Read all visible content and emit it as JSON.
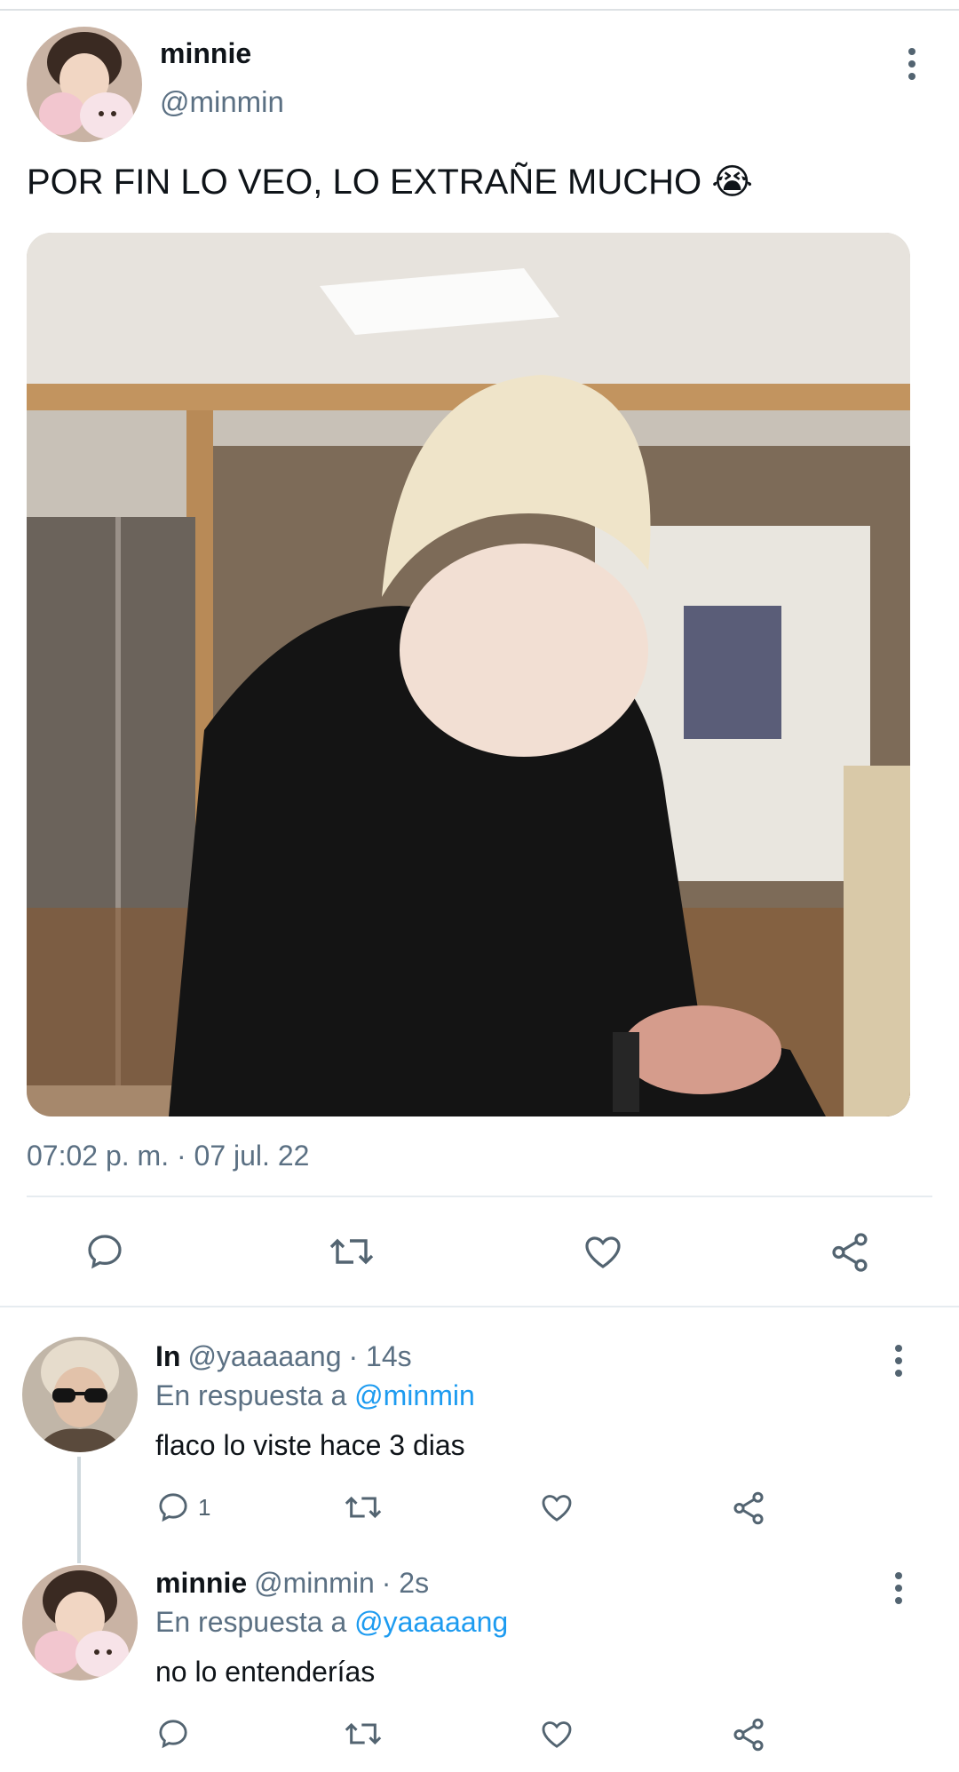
{
  "tweet": {
    "author_name": "minnie",
    "author_handle": "@minmin",
    "text": "POR FIN LO VEO, LO EXTRAÑE MUCHO",
    "emoji": "😭",
    "timestamp": "07:02 p. m. · 07 jul. 22"
  },
  "replies": [
    {
      "name": "In",
      "handle": "@yaaaaang",
      "time": "· 14s",
      "reply_prefix": "En respuesta a",
      "reply_to": "@minmin",
      "text": "flaco lo viste hace 3 dias",
      "reply_count": "1"
    },
    {
      "name": "minnie",
      "handle": "@minmin",
      "time": "· 2s",
      "reply_prefix": "En respuesta a",
      "reply_to": "@yaaaaang",
      "text": "no lo entenderías",
      "reply_count": ""
    }
  ],
  "icons": {
    "reply": "speech-bubble-icon",
    "retweet": "retweet-icon",
    "like": "heart-icon",
    "share": "share-icon",
    "more": "kebab-icon"
  },
  "colors": {
    "link": "#1d9bf0",
    "secondary_text": "#5b7083",
    "divider": "#e6ecf0"
  }
}
